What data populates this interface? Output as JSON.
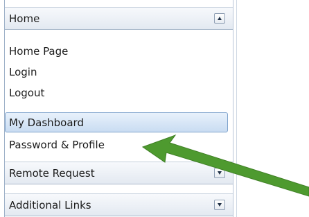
{
  "sections": [
    {
      "title": "Home",
      "toggle": "collapse",
      "items": [
        "Home Page",
        "Login",
        "Logout",
        "My Dashboard",
        "Password & Profile"
      ]
    },
    {
      "title": "Remote Request",
      "toggle": "expand"
    },
    {
      "title": "Additional Links",
      "toggle": "expand"
    }
  ],
  "selected_item": "My Dashboard",
  "colors": {
    "arrow": "#4e9a2f",
    "selected_bg": "#c9dcf2",
    "selected_border": "#7fa3cc",
    "header_bg": "#e3e9f1"
  },
  "icons": {
    "collapse": "chevron-up-icon",
    "expand": "chevron-down-icon",
    "annotation": "green-arrow-icon"
  }
}
